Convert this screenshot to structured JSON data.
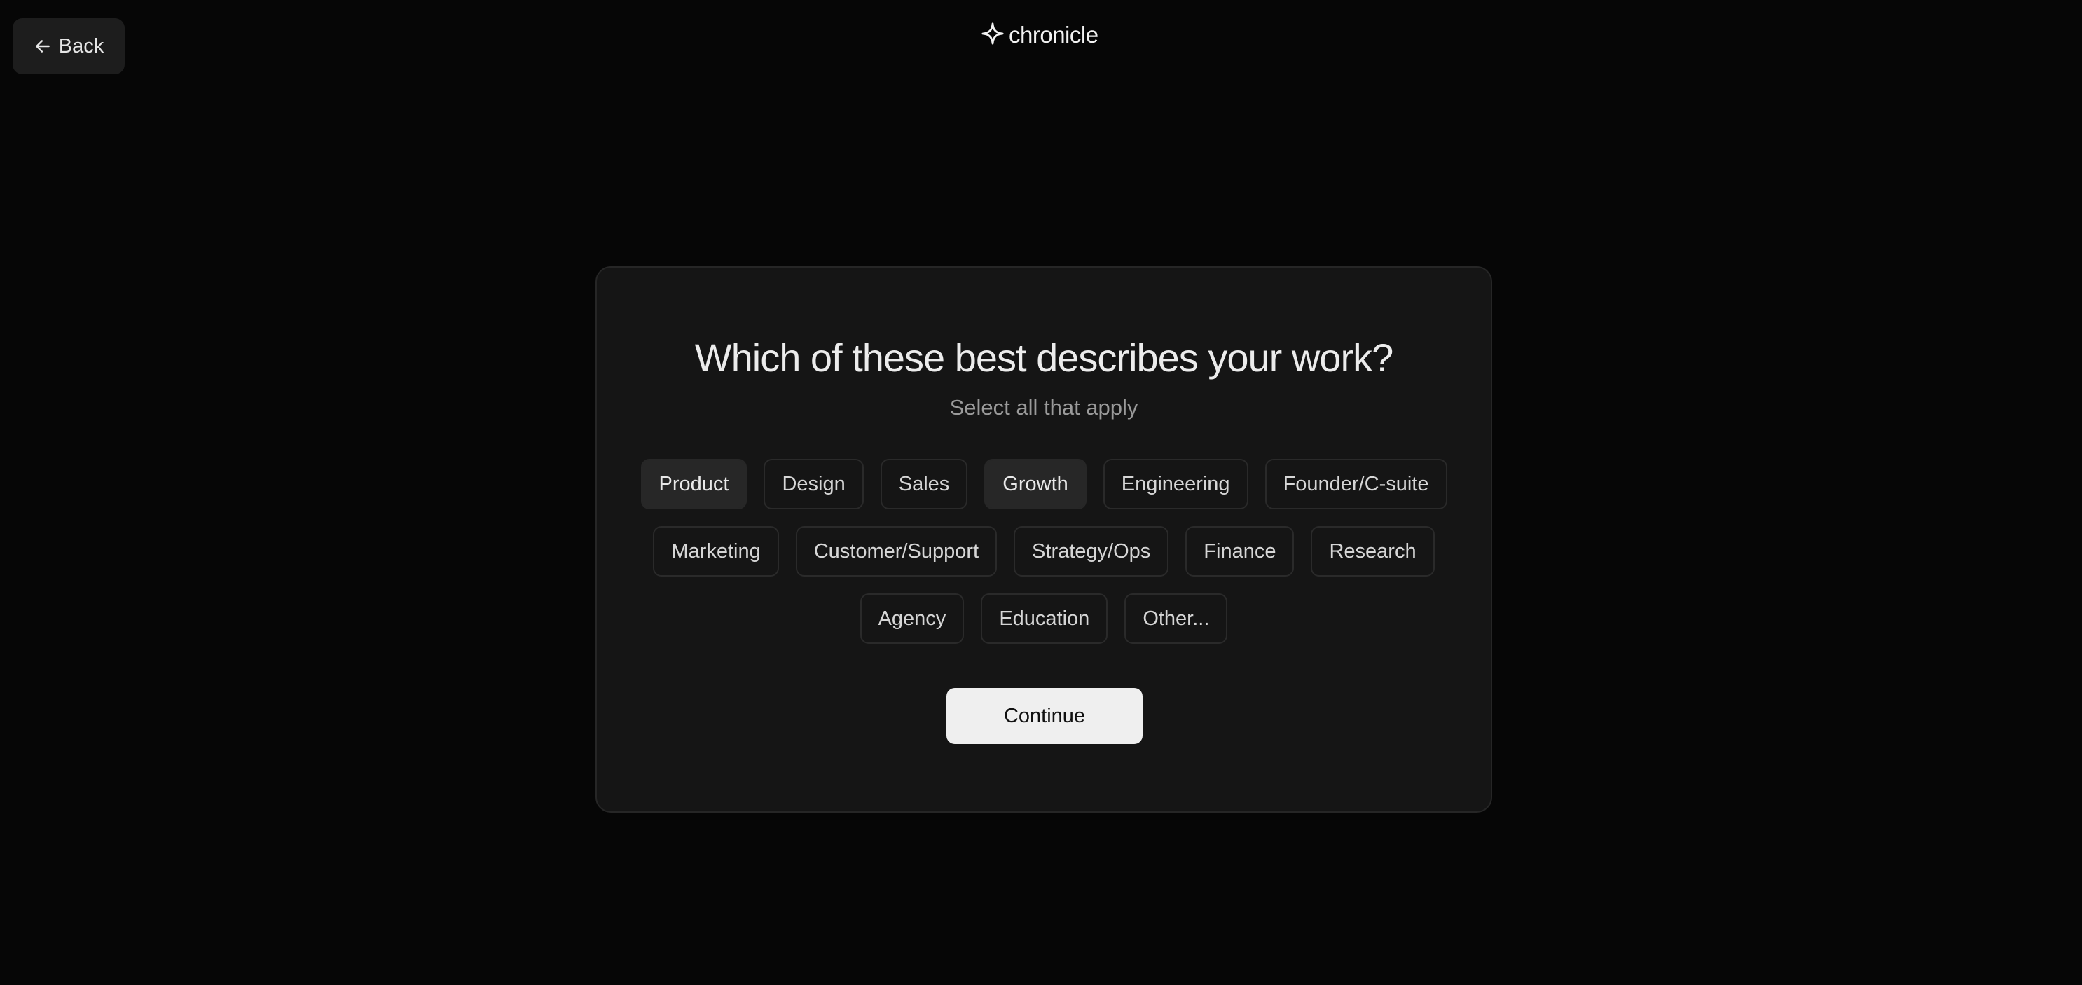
{
  "header": {
    "back_label": "Back",
    "brand_name": "chronicle",
    "back_icon": "arrow-left-icon",
    "brand_icon": "sparkle-star-icon"
  },
  "question": {
    "title": "Which of these best describes your work?",
    "subtitle": "Select all that apply"
  },
  "options": {
    "row1": [
      {
        "label": "Product",
        "selected": true
      },
      {
        "label": "Design",
        "selected": false
      },
      {
        "label": "Sales",
        "selected": false
      },
      {
        "label": "Growth",
        "selected": true
      },
      {
        "label": "Engineering",
        "selected": false
      },
      {
        "label": "Founder/C-suite",
        "selected": false
      }
    ],
    "row2": [
      {
        "label": "Marketing",
        "selected": false
      },
      {
        "label": "Customer/Support",
        "selected": false
      },
      {
        "label": "Strategy/Ops",
        "selected": false
      },
      {
        "label": "Finance",
        "selected": false
      },
      {
        "label": "Research",
        "selected": false
      }
    ],
    "row3": [
      {
        "label": "Agency",
        "selected": false
      },
      {
        "label": "Education",
        "selected": false
      },
      {
        "label": "Other...",
        "selected": false
      }
    ]
  },
  "actions": {
    "continue_label": "Continue"
  },
  "colors": {
    "background": "#060606",
    "card": "#151515",
    "chip_selected": "#272727",
    "continue_button": "#efefef"
  }
}
